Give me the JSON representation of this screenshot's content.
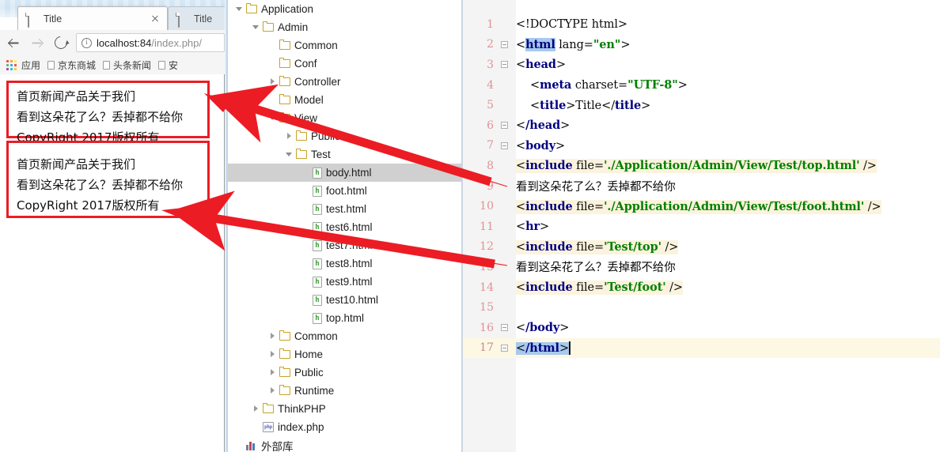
{
  "browser": {
    "tabs": [
      {
        "title": "Title",
        "active": true,
        "icon": "page-icon",
        "close": "close-icon"
      },
      {
        "title": "Title",
        "active": false,
        "icon": "page-icon"
      }
    ],
    "toolbar": {
      "back": "back-arrow-icon",
      "forward": "forward-arrow-icon",
      "reload": "reload-icon",
      "site_info": "info-icon",
      "url_host": "localhost:84",
      "url_path": "/index.php/"
    },
    "bookmarks": {
      "apps_label": "应用",
      "items": [
        "京东商城",
        "头条新闻",
        "安"
      ]
    },
    "rendered_pages": [
      {
        "nav": [
          "首页",
          "新闻",
          "产品",
          "关于我们"
        ],
        "body_text": "看到这朵花了么？丢掉都不给你",
        "footer": "CopyRight 2017版权所有"
      },
      {
        "nav": [
          "首页",
          "新闻",
          "产品",
          "关于我们"
        ],
        "body_text": "看到这朵花了么？丢掉都不给你",
        "footer": "CopyRight 2017版权所有"
      }
    ]
  },
  "tree": {
    "nodes": [
      {
        "label": "Application",
        "type": "folder",
        "indent": 1,
        "twist": "down"
      },
      {
        "label": "Admin",
        "type": "folder",
        "indent": 2,
        "twist": "down"
      },
      {
        "label": "Common",
        "type": "folder",
        "indent": 3,
        "twist": "none"
      },
      {
        "label": "Conf",
        "type": "folder",
        "indent": 3,
        "twist": "none"
      },
      {
        "label": "Controller",
        "type": "folder",
        "indent": 3,
        "twist": "right"
      },
      {
        "label": "Model",
        "type": "folder",
        "indent": 3,
        "twist": "none"
      },
      {
        "label": "View",
        "type": "folder",
        "indent": 3,
        "twist": "down"
      },
      {
        "label": "Public",
        "type": "folder",
        "indent": 4,
        "twist": "right"
      },
      {
        "label": "Test",
        "type": "folder",
        "indent": 4,
        "twist": "down"
      },
      {
        "label": "body.html",
        "type": "html",
        "indent": 5,
        "twist": "none",
        "selected": true
      },
      {
        "label": "foot.html",
        "type": "html",
        "indent": 5,
        "twist": "none"
      },
      {
        "label": "test.html",
        "type": "html",
        "indent": 5,
        "twist": "none"
      },
      {
        "label": "test6.html",
        "type": "html",
        "indent": 5,
        "twist": "none"
      },
      {
        "label": "test7.html",
        "type": "html",
        "indent": 5,
        "twist": "none"
      },
      {
        "label": "test8.html",
        "type": "html",
        "indent": 5,
        "twist": "none"
      },
      {
        "label": "test9.html",
        "type": "html",
        "indent": 5,
        "twist": "none"
      },
      {
        "label": "test10.html",
        "type": "html",
        "indent": 5,
        "twist": "none"
      },
      {
        "label": "top.html",
        "type": "html",
        "indent": 5,
        "twist": "none"
      },
      {
        "label": "Common",
        "type": "folder",
        "indent": 3,
        "twist": "right"
      },
      {
        "label": "Home",
        "type": "folder",
        "indent": 3,
        "twist": "right"
      },
      {
        "label": "Public",
        "type": "folder",
        "indent": 3,
        "twist": "right"
      },
      {
        "label": "Runtime",
        "type": "folder",
        "indent": 3,
        "twist": "right"
      },
      {
        "label": "ThinkPHP",
        "type": "folder",
        "indent": 2,
        "twist": "right"
      },
      {
        "label": "index.php",
        "type": "php",
        "indent": 2,
        "twist": "none"
      },
      {
        "label": "外部库",
        "type": "library",
        "indent": 1,
        "twist": "none"
      }
    ]
  },
  "editor": {
    "line_numbers": [
      "1",
      "2",
      "3",
      "4",
      "5",
      "6",
      "7",
      "8",
      "9",
      "10",
      "11",
      "12",
      "13",
      "14",
      "15",
      "16",
      "17"
    ],
    "lines": [
      {
        "n": "1",
        "text": "<!DOCTYPE html>"
      },
      {
        "n": "2",
        "text": "<html lang=\"en\">"
      },
      {
        "n": "3",
        "text": "<head>"
      },
      {
        "n": "4",
        "text": "    <meta charset=\"UTF-8\">"
      },
      {
        "n": "5",
        "text": "    <title>Title</title>"
      },
      {
        "n": "6",
        "text": "</head>"
      },
      {
        "n": "7",
        "text": "<body>"
      },
      {
        "n": "8",
        "text": "<include file='./Application/Admin/View/Test/top.html' />"
      },
      {
        "n": "9",
        "text": "看到这朵花了么？丢掉都不给你"
      },
      {
        "n": "10",
        "text": "<include file='./Application/Admin/View/Test/foot.html' />"
      },
      {
        "n": "11",
        "text": "<hr>"
      },
      {
        "n": "12",
        "text": "<include file='Test/top' />"
      },
      {
        "n": "13",
        "text": "看到这朵花了么？丢掉都不给你"
      },
      {
        "n": "14",
        "text": "<include file='Test/foot' />"
      },
      {
        "n": "15",
        "text": ""
      },
      {
        "n": "16",
        "text": "</body>"
      },
      {
        "n": "17",
        "text": "</html>"
      }
    ],
    "tokens": {
      "doctype": "<!DOCTYPE html>",
      "html_open_tag": "html",
      "lang_attr": " lang=",
      "lang_value": "\"en\"",
      "head_open": "head",
      "meta_tag": "meta",
      "charset_attr": " charset=",
      "charset_value": "\"UTF-8\"",
      "title_tag": "title",
      "title_text": "Title",
      "head_close": "/head",
      "body_open": "body",
      "include_kw": "include",
      "file_attr": " file=",
      "inc8_value": "'./Application/Admin/View/Test/top.html'",
      "inc10_value": "'./Application/Admin/View/Test/foot.html'",
      "inc12_value": "'Test/top'",
      "inc14_value": "'Test/foot'",
      "self_close": " />",
      "hr_tag": "hr",
      "chinese_line": "看到这朵花了么？丢掉都不给你",
      "body_close": "/body",
      "html_close": "/html"
    }
  },
  "annotations": {
    "highlight_color": "#ec1c24",
    "boxes": [
      {
        "name": "browser-output-box-1"
      },
      {
        "name": "browser-output-box-2"
      },
      {
        "name": "code-include-box-1"
      },
      {
        "name": "code-include-box-2"
      }
    ],
    "arrows": [
      {
        "name": "arrow-line9-to-output1",
        "from": "code line 9",
        "to": "browser box 1"
      },
      {
        "name": "arrow-line13-to-output2",
        "from": "code line 13",
        "to": "browser box 2"
      }
    ]
  }
}
